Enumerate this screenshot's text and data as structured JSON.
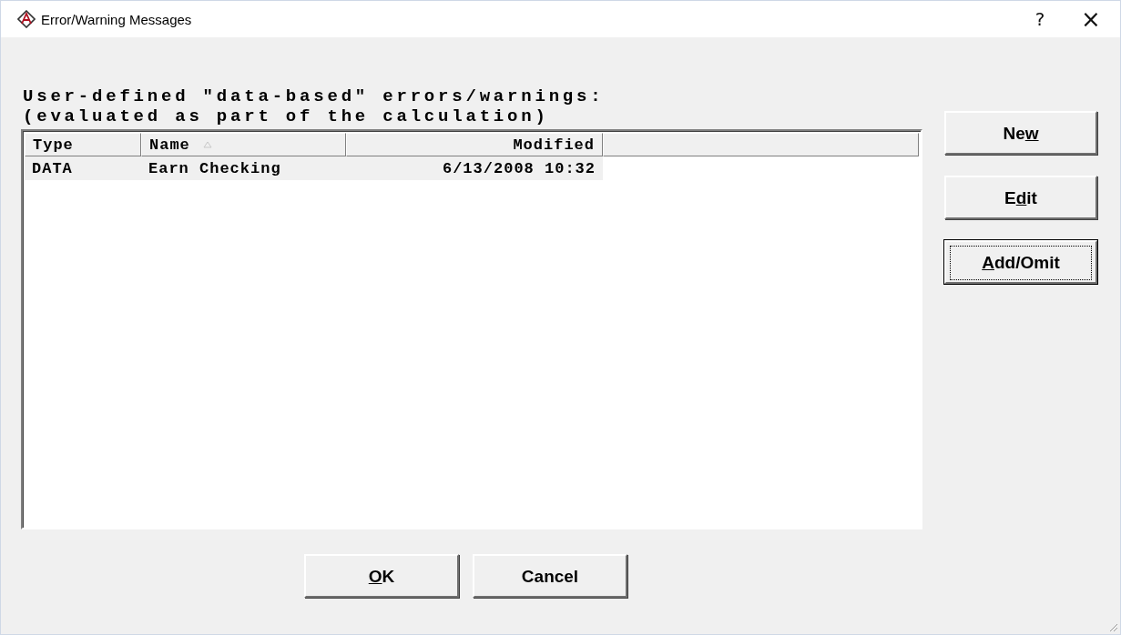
{
  "window": {
    "title": "Error/Warning Messages",
    "help": "?",
    "close": "×"
  },
  "description": [
    "User-defined \"data-based\" errors/warnings:",
    "(evaluated as part of the calculation)"
  ],
  "table": {
    "columns": [
      {
        "label": "Type",
        "sorted": false
      },
      {
        "label": "Name",
        "sorted": true
      },
      {
        "label": "Modified",
        "sorted": false
      }
    ],
    "rows": [
      {
        "selected": true,
        "cells": [
          "DATA",
          "Earn Checking",
          "6/13/2008 10:32"
        ]
      }
    ]
  },
  "side_buttons": [
    {
      "before": "Ne",
      "key": "w",
      "focused": false
    },
    {
      "before": "E",
      "key": "d",
      "after": "it",
      "focused": false
    },
    {
      "key": "A",
      "after": "dd/Omit",
      "focused": true
    }
  ],
  "buttons": [
    {
      "key": "O",
      "after": "K",
      "focused": false
    },
    {
      "before": "Cancel",
      "focused": false
    }
  ]
}
